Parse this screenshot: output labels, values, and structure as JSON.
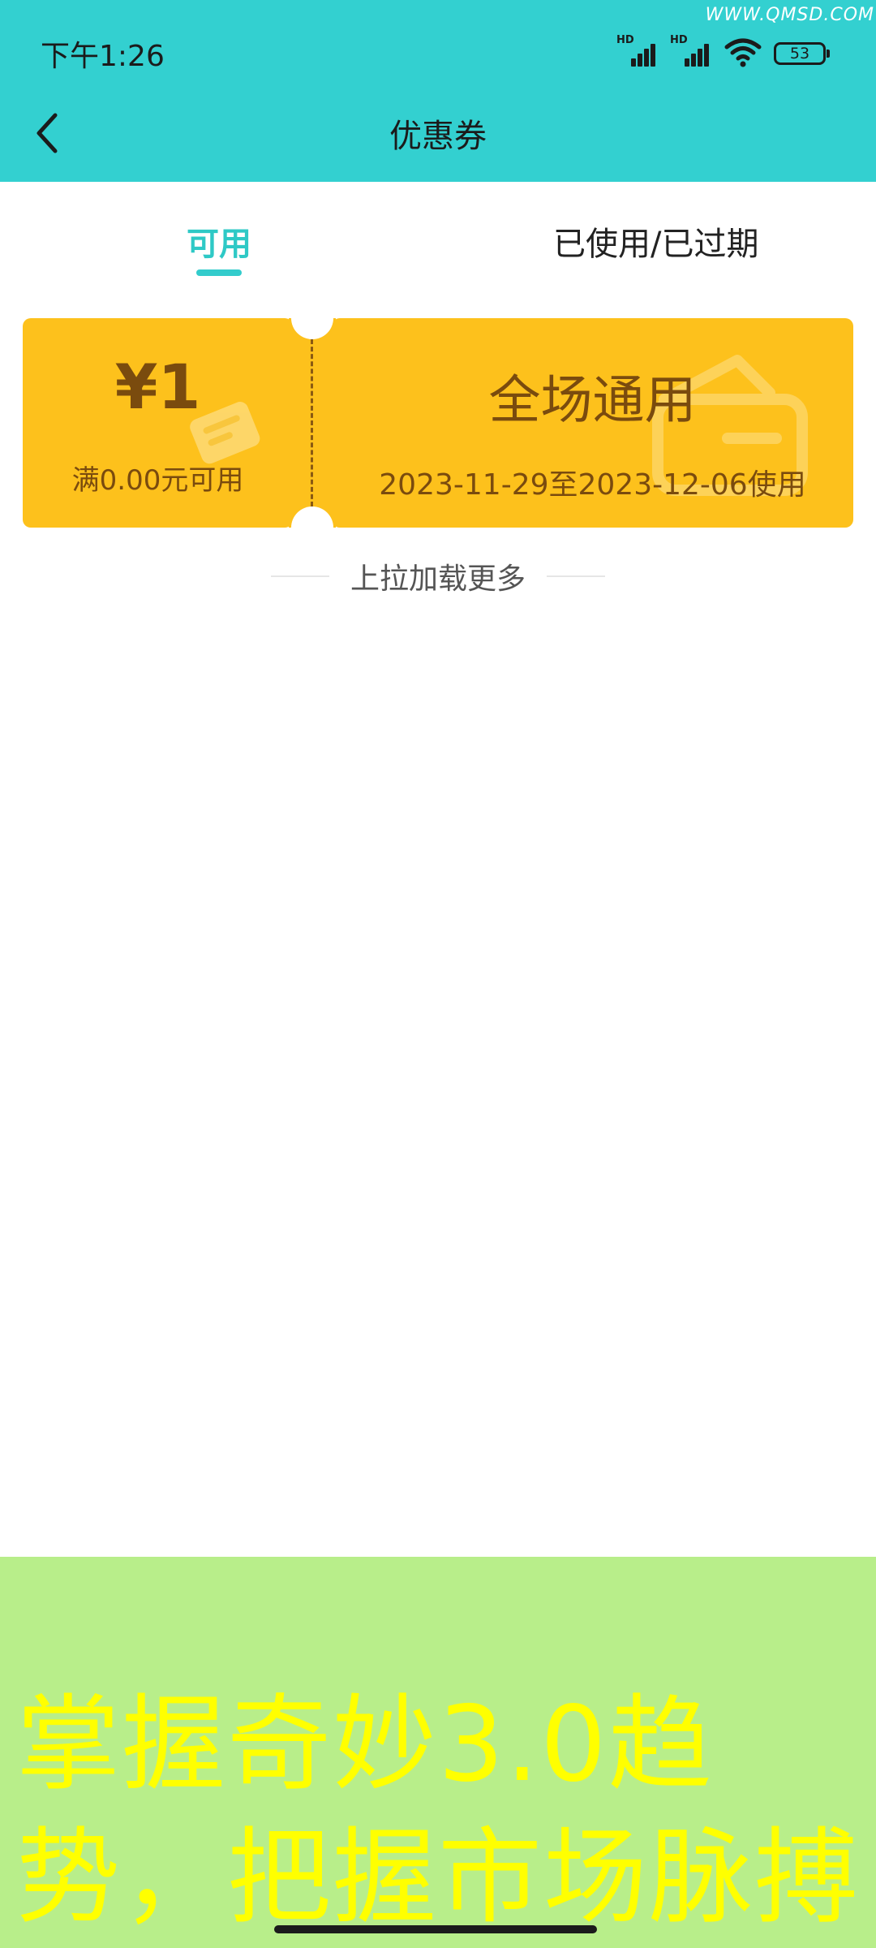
{
  "watermark": "WWW.QMSD.COM",
  "status_bar": {
    "time": "下午1:26",
    "signal_label": "HD",
    "battery": "53",
    "icons": [
      "signal-hd-icon",
      "signal-hd-icon",
      "wifi-icon",
      "battery-icon"
    ]
  },
  "title_bar": {
    "title": "优惠券",
    "back_icon": "chevron-left-icon"
  },
  "tabs": [
    {
      "label": "可用",
      "active": true
    },
    {
      "label": "已使用/已过期",
      "active": false
    }
  ],
  "coupons": [
    {
      "amount": "¥1",
      "threshold": "满0.00元可用",
      "name": "全场通用",
      "validity": "2023-11-29至2023-12-06使用"
    }
  ],
  "load_more": "上拉加载更多",
  "ad": {
    "line1": "掌握奇妙3.0趋",
    "line2": "势，把握市场脉搏"
  },
  "colors": {
    "header": "#33d0d0",
    "accent": "#2ec9c6",
    "coupon": "#fdc11c",
    "coupon_text": "#7a4b0e",
    "ad_background": "#b8ee8a",
    "ad_text": "#ffff00"
  }
}
